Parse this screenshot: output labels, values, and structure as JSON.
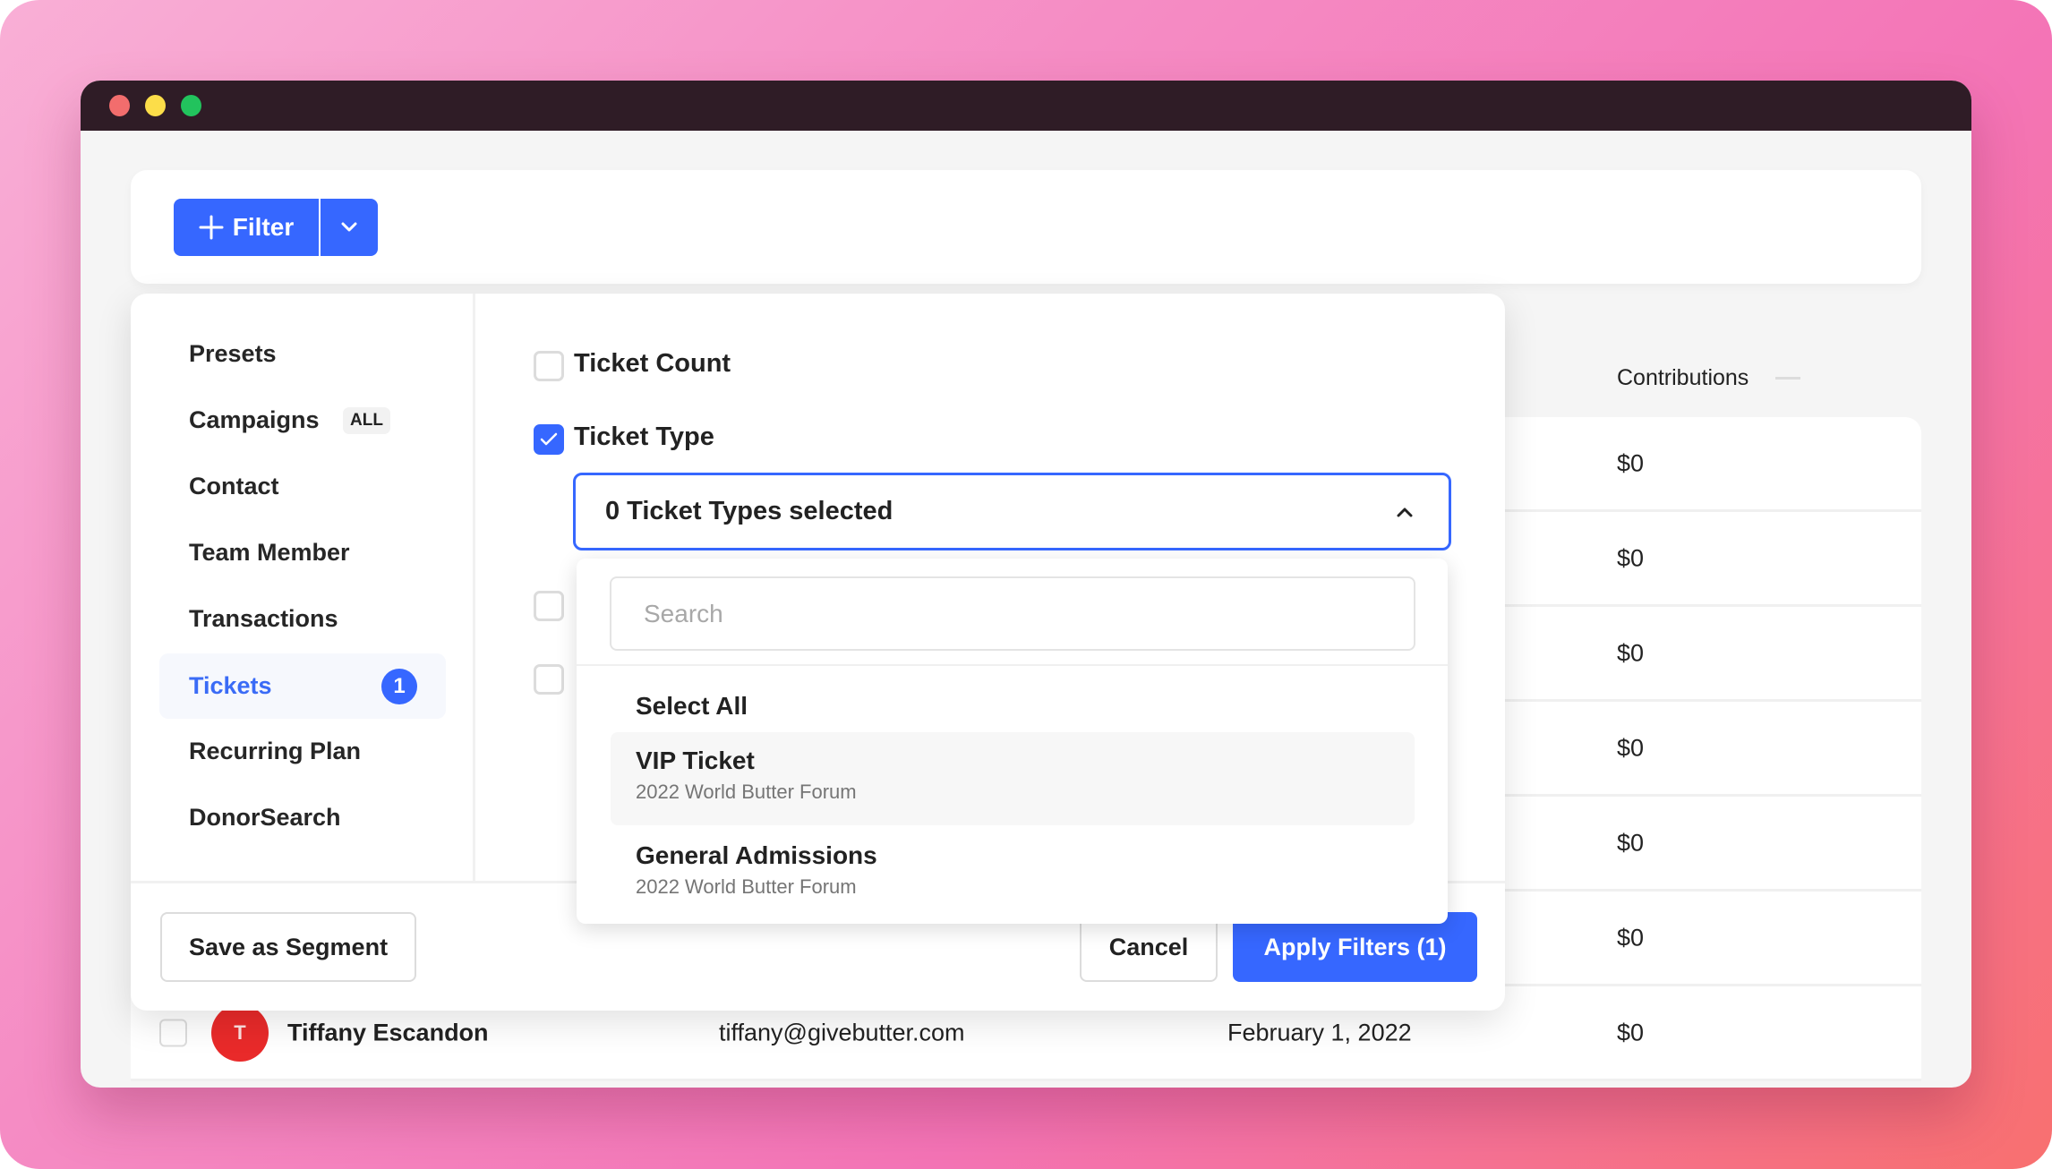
{
  "toolbar": {
    "filter_label": "Filter",
    "filter_icon": "plus-icon",
    "dropdown_icon": "chevron-down-icon"
  },
  "table": {
    "visible_column": "Contributions",
    "column_indicator_icon": "dash-icon",
    "rows": [
      {
        "contributions": "$0"
      },
      {
        "contributions": "$0"
      },
      {
        "contributions": "$0"
      },
      {
        "contributions": "$0"
      },
      {
        "contributions": "$0"
      },
      {
        "contributions": "$0"
      },
      {
        "avatar_initial": "T",
        "name": "Tiffany Escandon",
        "email": "tiffany@givebutter.com",
        "date": "February 1, 2022",
        "contributions": "$0"
      }
    ]
  },
  "filter_panel": {
    "sidebar": [
      {
        "label": "Presets"
      },
      {
        "label": "Campaigns",
        "badge": "ALL"
      },
      {
        "label": "Contact"
      },
      {
        "label": "Team Member"
      },
      {
        "label": "Transactions"
      },
      {
        "label": "Tickets",
        "count": "1",
        "active": true
      },
      {
        "label": "Recurring Plan"
      },
      {
        "label": "DonorSearch"
      }
    ],
    "options": [
      {
        "label": "Ticket Count",
        "checked": false
      },
      {
        "label": "Ticket Type",
        "checked": true
      }
    ],
    "ticket_type_select": {
      "value": "0 Ticket Types selected",
      "icon": "chevron-up-icon",
      "search_placeholder": "Search",
      "select_all": "Select All",
      "items": [
        {
          "title": "VIP Ticket",
          "subtitle": "2022 World Butter Forum",
          "highlighted": true
        },
        {
          "title": "General Admissions",
          "subtitle": "2022 World Butter Forum",
          "highlighted": false
        }
      ]
    },
    "footer": {
      "save_segment": "Save as Segment",
      "cancel": "Cancel",
      "apply": "Apply Filters (1)"
    }
  },
  "colors": {
    "accent": "#3667ff",
    "titlebar": "#2f1c26",
    "avatar": "#e92a2a"
  }
}
